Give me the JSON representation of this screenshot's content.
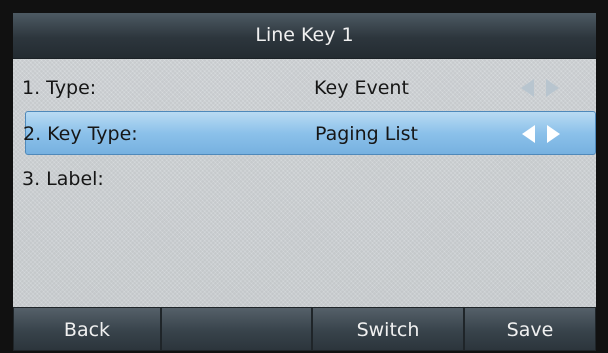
{
  "title": "Line Key 1",
  "rows": [
    {
      "label": "1. Type:",
      "value": "Key Event",
      "has_arrows": true
    },
    {
      "label": "2. Key Type:",
      "value": "Paging List",
      "has_arrows": true,
      "selected": true
    },
    {
      "label": "3. Label:",
      "value": ""
    }
  ],
  "softkeys": [
    {
      "label": "Back"
    },
    {
      "label": ""
    },
    {
      "label": "Switch"
    },
    {
      "label": "Save"
    }
  ],
  "icons": {
    "left_arrow": "triangle-left",
    "right_arrow": "triangle-right"
  },
  "colors": {
    "title_bar": "#2d363d",
    "selected_row": "#8cc1ea",
    "background": "#d2d6d9",
    "arrow_inactive": "#b8c5cf",
    "arrow_active": "#ffffff"
  }
}
